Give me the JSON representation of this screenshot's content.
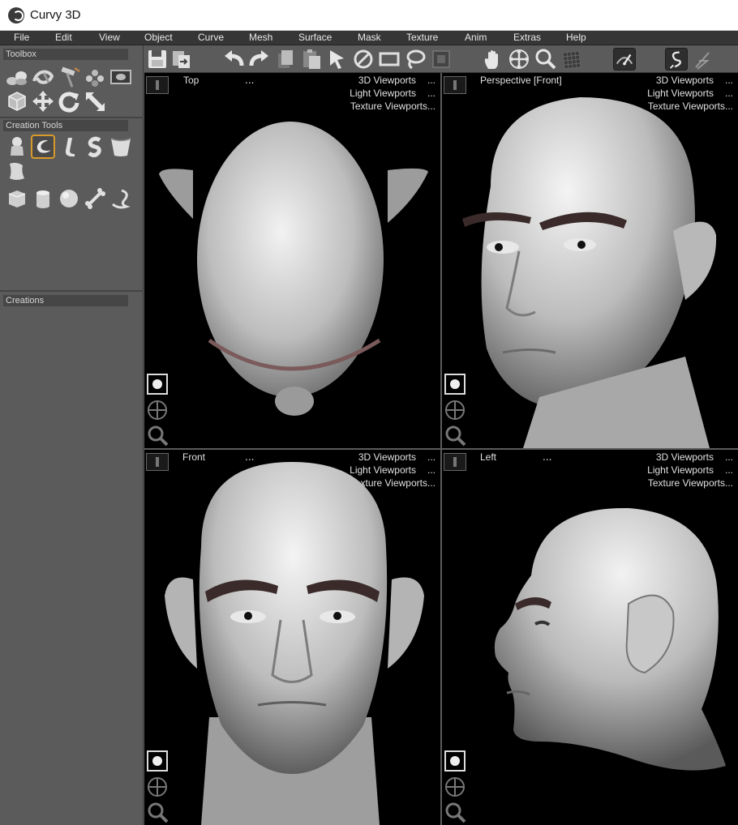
{
  "window": {
    "title": "Curvy 3D"
  },
  "menu": [
    "File",
    "Edit",
    "View",
    "Object",
    "Curve",
    "Mesh",
    "Surface",
    "Mask",
    "Texture",
    "Anim",
    "Extras",
    "Help"
  ],
  "panels": {
    "toolbox": "Toolbox",
    "creation_tools": "Creation Tools",
    "creations": "Creations"
  },
  "viewport_menu": {
    "viewports_3d": "3D Viewports",
    "light_viewports": "Light Viewports",
    "texture_viewports": "Texture Viewports...",
    "more": "..."
  },
  "viewports": [
    {
      "name": "Top",
      "dots": "..."
    },
    {
      "name": "Perspective [Front]",
      "dots": ""
    },
    {
      "name": "Front",
      "dots": "..."
    },
    {
      "name": "Left",
      "dots": "..."
    }
  ],
  "colors": {
    "accent_selected": "#d89a2a",
    "panel_bg": "#5b5b5b",
    "menubar_bg": "#363636",
    "viewport_bg": "#000000",
    "skin": "#cfcfcf",
    "eyebrow": "#3a2a2a"
  },
  "icons": {
    "toolbox": [
      "combine-objects-icon",
      "twist-icon",
      "hammer-icon",
      "scatter-icon",
      "image-icon",
      "cube-select-icon",
      "move-arrows-icon",
      "rotate-icon",
      "scale-arrow-icon"
    ],
    "creation": [
      "blob-icon",
      "curve-tool-icon",
      "bend-icon",
      "s-curve-icon",
      "shell-icon",
      "sheet-icon",
      "box-primitive-icon",
      "cylinder-primitive-icon",
      "sphere-primitive-icon",
      "bone-primitive-icon",
      "tube-primitive-icon"
    ],
    "toolbar": [
      "save-icon",
      "import-icon",
      "undo-icon",
      "redo-icon",
      "copy-icon",
      "paste-icon",
      "select-arrow-icon",
      "deselect-icon",
      "rect-select-icon",
      "lasso-select-icon",
      "mask-select-icon",
      "pan-hand-icon",
      "move-view-icon",
      "zoom-icon",
      "grid-icon",
      "render-view-icon",
      "curve-draw-icon",
      "curve-edit-icon"
    ]
  }
}
